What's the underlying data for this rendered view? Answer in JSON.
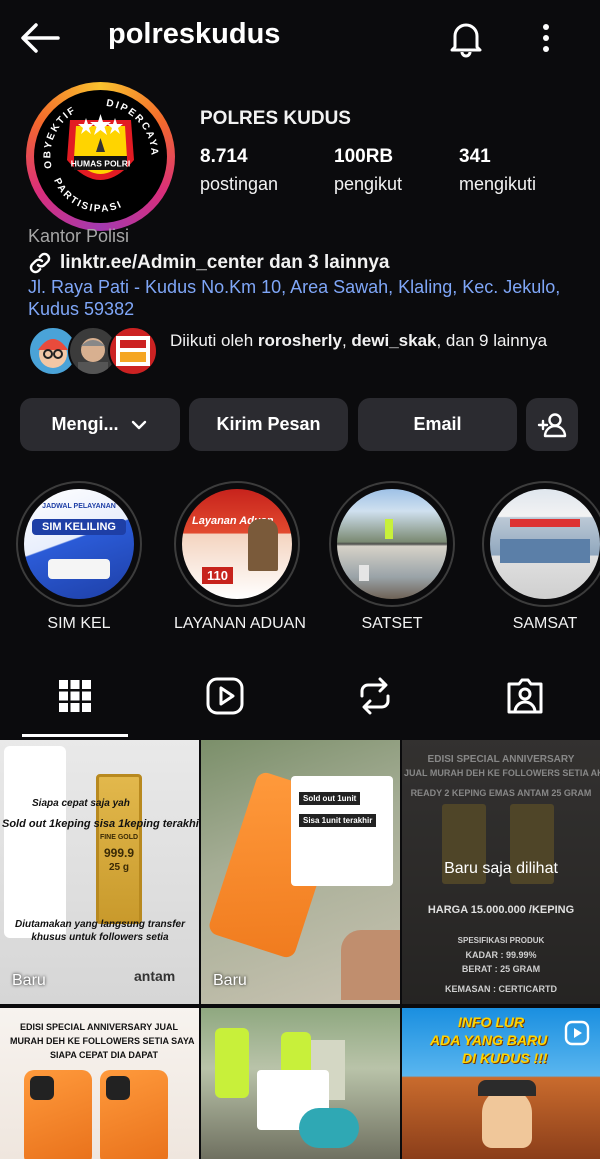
{
  "header": {
    "username": "polreskudus"
  },
  "profile": {
    "display_name": "POLRES KUDUS",
    "logo_text": {
      "arc_left": "OBYEKTIF",
      "arc_right": "DIPERCAYA",
      "arc_bottom": "PARTISIPASI",
      "badge": "HUMAS POLRI"
    },
    "stats": [
      {
        "value": "8.714",
        "label": "postingan"
      },
      {
        "value": "100RB",
        "label": "pengikut"
      },
      {
        "value": "341",
        "label": "mengikuti"
      }
    ],
    "category": "Kantor Polisi",
    "link": "linktr.ee/Admin_center dan 3 lainnya",
    "address": "Jl. Raya Pati - Kudus No.Km 10, Area Sawah, Klaling, Kec. Jekulo, Kudus 59382",
    "followed_by": {
      "prefix": "Diikuti oleh ",
      "user1": "rorosherly",
      "sep": ", ",
      "user2": "dewi_skak",
      "suffix": ", dan 9 lainnya"
    }
  },
  "actions": {
    "following_label": "Mengi...",
    "message_label": "Kirim Pesan",
    "email_label": "Email"
  },
  "highlights": [
    {
      "label": "SIM KEL",
      "cover_title": "SIM KELILING",
      "cover_sub": "JADWAL PELAYANAN"
    },
    {
      "label": "LAYANAN ADUAN",
      "cover_title": "Layanan Aduan",
      "cover_sub": "110"
    },
    {
      "label": "SATSET",
      "cover_title": "",
      "cover_sub": ""
    },
    {
      "label": "SAMSAT",
      "cover_title": "",
      "cover_sub": ""
    }
  ],
  "posts": [
    {
      "badge": "Baru",
      "lines": [
        "Siapa cepat saja yah",
        "Sold out 1keping sisa 1keping terakhir",
        "Diutamakan yang langsung transfer khusus untuk followers setia"
      ],
      "gold_lines": [
        "FINE GOLD",
        "999.9",
        "25 g"
      ],
      "brand": "antam"
    },
    {
      "badge": "Baru",
      "lines": [
        "Sold out 1unit",
        "Sisa 1unit terakhir"
      ]
    },
    {
      "overlay": "Baru saja dilihat",
      "lines": [
        "EDISI SPECIAL ANNIVERSARY",
        "JUAL MURAH DEH KE FOLLOWERS SETIA AKU",
        "READY 2 KEPING EMAS ANTAM 25 GRAM",
        "HARGA 15.000.000 /KEPING",
        "SPESIFIKASI PRODUK",
        "KADAR : 99.99%",
        "BERAT : 25 GRAM",
        "KEMASAN : CERTICARTD"
      ]
    },
    {
      "lines": [
        "EDISI SPECIAL ANNIVERSARY JUAL",
        "MURAH DEH KE FOLLOWERS SETIA SAYA",
        "SIAPA CEPAT DIA DAPAT"
      ]
    },
    {
      "lines": []
    },
    {
      "lines": [
        "INFO LUR",
        "ADA YANG BARU",
        "DI KUDUS !!!"
      ]
    }
  ],
  "colors": {
    "background": "#0b0b0d",
    "button_bg": "#2b2b30",
    "link_blue": "#7fa6f7",
    "muted_text": "#a6a6a6"
  }
}
